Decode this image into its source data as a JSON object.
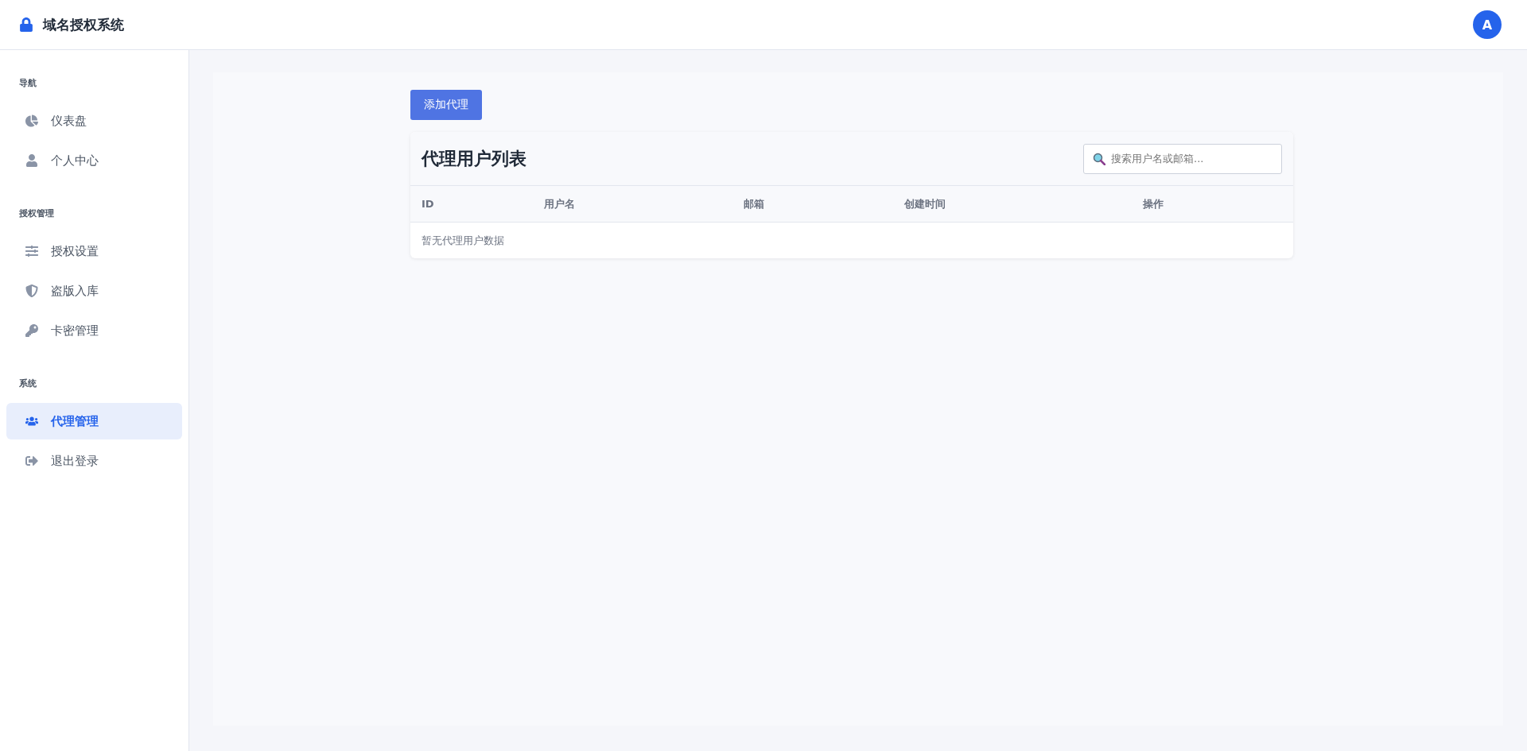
{
  "header": {
    "title": "域名授权系统",
    "avatar": "A"
  },
  "sidebar": {
    "sections": [
      {
        "title": "导航",
        "items": [
          {
            "label": "仪表盘",
            "selected": false
          },
          {
            "label": "个人中心",
            "selected": false
          }
        ]
      },
      {
        "title": "授权管理",
        "items": [
          {
            "label": "授权设置",
            "selected": false
          },
          {
            "label": "盗版入库",
            "selected": false
          },
          {
            "label": "卡密管理",
            "selected": false
          }
        ]
      },
      {
        "title": "系统",
        "items": [
          {
            "label": "代理管理",
            "selected": true
          },
          {
            "label": "退出登录",
            "selected": false
          }
        ]
      }
    ]
  },
  "main": {
    "add_button": "添加代理",
    "card": {
      "title": "代理用户列表",
      "search": {
        "placeholder": "搜索用户名或邮箱..."
      },
      "table": {
        "columns": [
          "ID",
          "用户名",
          "邮箱",
          "创建时间",
          "操作"
        ],
        "empty_text": "暂无代理用户数据"
      }
    }
  }
}
